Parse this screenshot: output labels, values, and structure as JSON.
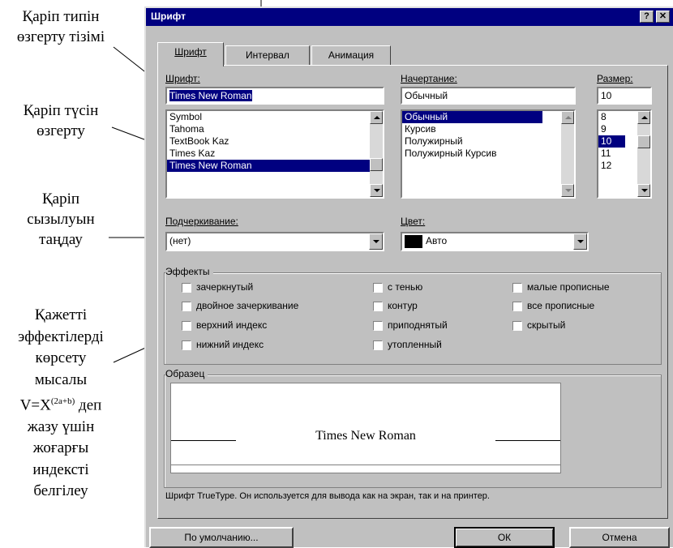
{
  "annotations": {
    "a1_line1": "Қаріп типін",
    "a1_line2": "өзгерту тізімі",
    "a2_line1": "Қаріп түсін",
    "a2_line2": "өзгерту",
    "a3_line1": "Қаріп",
    "a3_line2": "сызылуын",
    "a3_line3": "таңдау",
    "a4_line1": "Қажетті",
    "a4_line2": "эффектілерді",
    "a4_line3": "көрсету",
    "a4_line4": "мысалы",
    "a4_formula_base": "V=X",
    "a4_formula_sup": "(2a+b)",
    "a4_formula_tail": " деп",
    "a4_line6": "жазу үшін",
    "a4_line7": "жоғарғы",
    "a4_line8": "индексті",
    "a4_line9": "белгілеу"
  },
  "dialog": {
    "title": "Шрифт",
    "help_button": "?",
    "close_button": "✕",
    "tabs": [
      "Шрифт",
      "Интервал",
      "Анимация"
    ],
    "font_label": "Шрифт:",
    "font_value": "Times New Roman",
    "font_list": [
      "Symbol",
      "Tahoma",
      "TextBook Kaz",
      "Times Kaz",
      "Times New Roman"
    ],
    "style_label": "Начертание:",
    "style_value": "Обычный",
    "style_list": [
      "Обычный",
      "Курсив",
      "Полужирный",
      "Полужирный Курсив"
    ],
    "size_label": "Размер:",
    "size_value": "10",
    "size_list": [
      "8",
      "9",
      "10",
      "11",
      "12"
    ],
    "underline_label": "Подчеркивание:",
    "underline_value": "(нет)",
    "color_label": "Цвет:",
    "color_value": "Авто",
    "effects_label": "Эффекты",
    "effects": {
      "strikethrough": "зачеркнутый",
      "double_strikethrough": "двойное зачеркивание",
      "superscript": "верхний индекс",
      "subscript": "нижний индекс",
      "shadow": "с тенью",
      "outline": "контур",
      "emboss": "приподнятый",
      "engrave": "утопленный",
      "small_caps": "малые прописные",
      "all_caps": "все прописные",
      "hidden": "скрытый"
    },
    "preview_label": "Образец",
    "preview_text": "Times New Roman",
    "info_text": "Шрифт TrueType. Он используется для вывода как на экран, так и на принтер.",
    "default_button": "По умолчанию...",
    "ok_button": "ОК",
    "cancel_button": "Отмена"
  },
  "colors": {
    "title_bar": "#000080",
    "selection": "#000080",
    "face": "#c0c0c0"
  }
}
